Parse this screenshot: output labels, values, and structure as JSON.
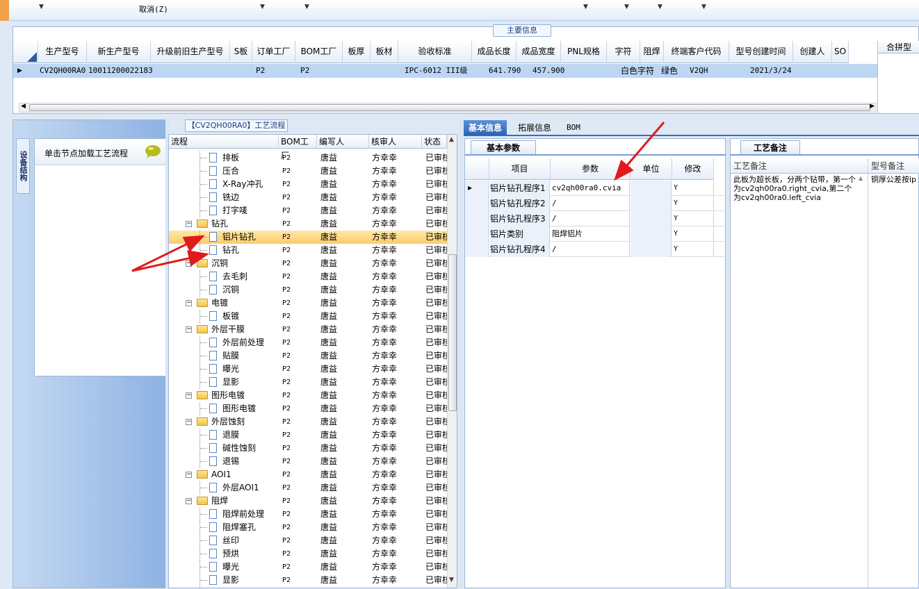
{
  "toolbar": {
    "cancel_label": "取消(Z)"
  },
  "main_info": {
    "title": "主要信息",
    "columns": [
      "生产型号",
      "新生产型号",
      "升级前旧生产型号",
      "S板",
      "订单工厂",
      "BOM工厂",
      "板厚",
      "板材",
      "验收标准",
      "成品长度",
      "成品宽度",
      "PNL规格",
      "字符",
      "阻焊",
      "终端客户代码",
      "型号创建时间",
      "创建人",
      "SO"
    ],
    "row": {
      "model": "CV2QH00RA0",
      "new_model": "10011200022183",
      "order_factory": "P2",
      "bom_factory": "P2",
      "standard": "IPC-6012 III级",
      "length": "641.790",
      "width": "457.900",
      "char": "白色字符",
      "solder": "绿色",
      "customer": "V2QH",
      "created": "2021/3/24"
    },
    "merge_title": "合拼型"
  },
  "left_panel": {
    "vtab_label": "设备结构",
    "load_hint": "单击节点加载工艺流程"
  },
  "flow": {
    "title": "【CV2QH00RA0】工艺流程",
    "headers": [
      "流程",
      "BOM工厂",
      "编写人",
      "核审人",
      "状态"
    ],
    "rows": [
      {
        "name": "排板",
        "level": 1,
        "factory": "P2",
        "writer": "唐益",
        "reviewer": "方幸幸",
        "status": "已审核"
      },
      {
        "name": "压合",
        "level": 1,
        "factory": "P2",
        "writer": "唐益",
        "reviewer": "方幸幸",
        "status": "已审核"
      },
      {
        "name": "X-Ray冲孔",
        "level": 1,
        "factory": "P2",
        "writer": "唐益",
        "reviewer": "方幸幸",
        "status": "已审核"
      },
      {
        "name": "铣边",
        "level": 1,
        "factory": "P2",
        "writer": "唐益",
        "reviewer": "方幸幸",
        "status": "已审核"
      },
      {
        "name": "打字唛",
        "level": 1,
        "factory": "P2",
        "writer": "唐益",
        "reviewer": "方幸幸",
        "status": "已审核"
      },
      {
        "name": "钻孔",
        "level": 0,
        "factory": "P2",
        "writer": "唐益",
        "reviewer": "方幸幸",
        "status": "已审核"
      },
      {
        "name": "铝片钻孔",
        "level": 1,
        "factory": "P2",
        "writer": "唐益",
        "reviewer": "方幸幸",
        "status": "已审核",
        "selected": true
      },
      {
        "name": "钻孔",
        "level": 1,
        "factory": "P2",
        "writer": "唐益",
        "reviewer": "方幸幸",
        "status": "已审核"
      },
      {
        "name": "沉铜",
        "level": 0,
        "factory": "P2",
        "writer": "唐益",
        "reviewer": "方幸幸",
        "status": "已审核"
      },
      {
        "name": "去毛刺",
        "level": 1,
        "factory": "P2",
        "writer": "唐益",
        "reviewer": "方幸幸",
        "status": "已审核"
      },
      {
        "name": "沉铜",
        "level": 1,
        "factory": "P2",
        "writer": "唐益",
        "reviewer": "方幸幸",
        "status": "已审核"
      },
      {
        "name": "电镀",
        "level": 0,
        "factory": "P2",
        "writer": "唐益",
        "reviewer": "方幸幸",
        "status": "已审核"
      },
      {
        "name": "板镀",
        "level": 1,
        "factory": "P2",
        "writer": "唐益",
        "reviewer": "方幸幸",
        "status": "已审核"
      },
      {
        "name": "外层干膜",
        "level": 0,
        "factory": "P2",
        "writer": "唐益",
        "reviewer": "方幸幸",
        "status": "已审核"
      },
      {
        "name": "外层前处理",
        "level": 1,
        "factory": "P2",
        "writer": "唐益",
        "reviewer": "方幸幸",
        "status": "已审核"
      },
      {
        "name": "贴膜",
        "level": 1,
        "factory": "P2",
        "writer": "唐益",
        "reviewer": "方幸幸",
        "status": "已审核"
      },
      {
        "name": "曝光",
        "level": 1,
        "factory": "P2",
        "writer": "唐益",
        "reviewer": "方幸幸",
        "status": "已审核"
      },
      {
        "name": "显影",
        "level": 1,
        "factory": "P2",
        "writer": "唐益",
        "reviewer": "方幸幸",
        "status": "已审核"
      },
      {
        "name": "图形电镀",
        "level": 0,
        "factory": "P2",
        "writer": "唐益",
        "reviewer": "方幸幸",
        "status": "已审核"
      },
      {
        "name": "图形电镀",
        "level": 1,
        "factory": "P2",
        "writer": "唐益",
        "reviewer": "方幸幸",
        "status": "已审核"
      },
      {
        "name": "外层蚀刻",
        "level": 0,
        "factory": "P2",
        "writer": "唐益",
        "reviewer": "方幸幸",
        "status": "已审核"
      },
      {
        "name": "退膜",
        "level": 1,
        "factory": "P2",
        "writer": "唐益",
        "reviewer": "方幸幸",
        "status": "已审核"
      },
      {
        "name": "碱性蚀刻",
        "level": 1,
        "factory": "P2",
        "writer": "唐益",
        "reviewer": "方幸幸",
        "status": "已审核"
      },
      {
        "name": "退锡",
        "level": 1,
        "factory": "P2",
        "writer": "唐益",
        "reviewer": "方幸幸",
        "status": "已审核"
      },
      {
        "name": "AOI1",
        "level": 0,
        "factory": "P2",
        "writer": "唐益",
        "reviewer": "方幸幸",
        "status": "已审核"
      },
      {
        "name": "外层AOI1",
        "level": 1,
        "factory": "P2",
        "writer": "唐益",
        "reviewer": "方幸幸",
        "status": "已审核"
      },
      {
        "name": "阻焊",
        "level": 0,
        "factory": "P2",
        "writer": "唐益",
        "reviewer": "方幸幸",
        "status": "已审核"
      },
      {
        "name": "阻焊前处理",
        "level": 1,
        "factory": "P2",
        "writer": "唐益",
        "reviewer": "方幸幸",
        "status": "已审核"
      },
      {
        "name": "阻焊塞孔",
        "level": 1,
        "factory": "P2",
        "writer": "唐益",
        "reviewer": "方幸幸",
        "status": "已审核"
      },
      {
        "name": "丝印",
        "level": 1,
        "factory": "P2",
        "writer": "唐益",
        "reviewer": "方幸幸",
        "status": "已审核"
      },
      {
        "name": "预烘",
        "level": 1,
        "factory": "P2",
        "writer": "唐益",
        "reviewer": "方幸幸",
        "status": "已审核"
      },
      {
        "name": "曝光",
        "level": 1,
        "factory": "P2",
        "writer": "唐益",
        "reviewer": "方幸幸",
        "status": "已审核"
      },
      {
        "name": "显影",
        "level": 1,
        "factory": "P2",
        "writer": "唐益",
        "reviewer": "方幸幸",
        "status": "已审核"
      }
    ]
  },
  "tabs": [
    "基本信息",
    "拓展信息",
    "BOM"
  ],
  "params": {
    "tab_label": "基本参数",
    "headers": [
      "项目",
      "参数",
      "单位",
      "修改"
    ],
    "rows": [
      {
        "item": "铝片钻孔程序1",
        "param": "cv2qh00ra0.cvia",
        "unit": "",
        "mod": "Y"
      },
      {
        "item": "铝片钻孔程序2",
        "param": "/",
        "unit": "",
        "mod": "Y"
      },
      {
        "item": "铝片钻孔程序3",
        "param": "/",
        "unit": "",
        "mod": "Y"
      },
      {
        "item": "铝片类别",
        "param": "阻焊铝片",
        "unit": "",
        "mod": "Y"
      },
      {
        "item": "铝片钻孔程序4",
        "param": "/",
        "unit": "",
        "mod": "Y"
      }
    ]
  },
  "notes": {
    "tab_label": "工艺备注",
    "col1": "工艺备注",
    "col2": "型号备注",
    "text1": "此板为超长板，分两个钻带，第一个为cv2qh00ra0.right_cvia,第二个为cv2qh00ra0.left_cvia",
    "text2": "铜厚公差按ip"
  }
}
